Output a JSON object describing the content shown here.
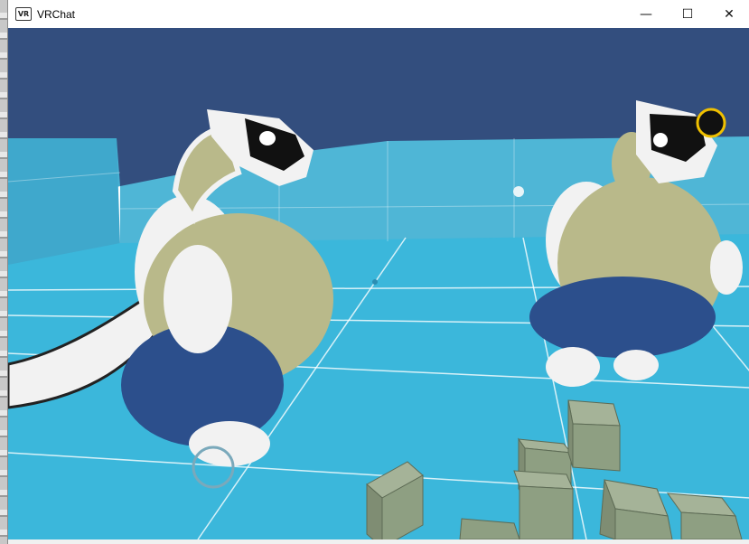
{
  "window": {
    "title": "VRChat",
    "app_icon_text": "VR",
    "controls": {
      "minimize_glyph": "—",
      "maximize_glyph": "☐",
      "close_glyph": "✕"
    }
  },
  "scene": {
    "sky_color": "#334e7e",
    "wall_color": "#47b3d6",
    "floor_color": "#3ab6da",
    "grid_color": "#ffffff",
    "avatar_body_color": "#f2f2f2",
    "avatar_belly_color": "#b9b98a",
    "avatar_shorts_color": "#2c4f8c",
    "cube_color": "#8e9f82"
  }
}
